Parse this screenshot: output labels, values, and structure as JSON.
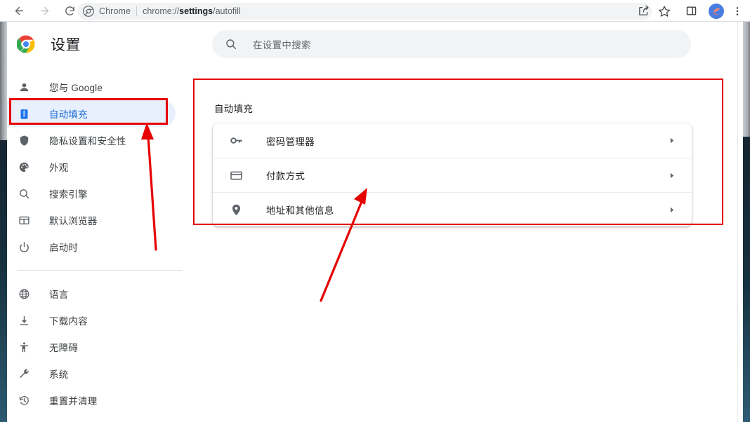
{
  "browser": {
    "back_icon": "back-arrow-icon",
    "forward_icon": "forward-arrow-icon",
    "reload_icon": "reload-icon",
    "omnibox": {
      "chrome_icon": "chrome-logo-icon",
      "scheme_label": "Chrome",
      "url_prefix": "chrome://",
      "url_bold": "settings",
      "url_suffix": "/autofill",
      "full_url": "chrome://settings/autofill"
    },
    "actions": [
      {
        "name": "share-icon",
        "label": "Share"
      },
      {
        "name": "bookmark-star-icon",
        "label": "Bookmark this tab"
      },
      {
        "name": "side-panel-icon",
        "label": "Side panel"
      },
      {
        "name": "avatar",
        "label": "Profile"
      },
      {
        "name": "three-dot-menu-icon",
        "label": "Customize and control Google Chrome"
      }
    ],
    "avatar_bg": "#4a7de0",
    "avatar_fg": "#f08a7a"
  },
  "settings": {
    "brand": {
      "logo_icon": "chrome-logo-icon",
      "title": "设置"
    },
    "search": {
      "icon": "search-icon",
      "placeholder": "在设置中搜索",
      "value": ""
    },
    "sidebar": {
      "group_1": [
        {
          "icon": "person-icon",
          "label": "您与 Google",
          "active": false
        },
        {
          "icon": "clipboard-icon",
          "label": "自动填充",
          "active": true
        },
        {
          "icon": "shield-icon",
          "label": "隐私设置和安全性",
          "active": false
        },
        {
          "icon": "palette-icon",
          "label": "外观",
          "active": false
        },
        {
          "icon": "search-icon",
          "label": "搜索引擎",
          "active": false
        },
        {
          "icon": "browser-icon",
          "label": "默认浏览器",
          "active": false
        },
        {
          "icon": "power-icon",
          "label": "启动时",
          "active": false
        }
      ],
      "group_2": [
        {
          "icon": "globe-icon",
          "label": "语言",
          "active": false
        },
        {
          "icon": "download-icon",
          "label": "下载内容",
          "active": false
        },
        {
          "icon": "accessibility-icon",
          "label": "无障碍",
          "active": false
        },
        {
          "icon": "wrench-icon",
          "label": "系统",
          "active": false
        },
        {
          "icon": "restore-icon",
          "label": "重置并清理",
          "active": false
        }
      ],
      "active_bg": "#e8f0fe",
      "active_fg": "#1967d2"
    },
    "main": {
      "section_title": "自动填充",
      "rows": [
        {
          "icon": "key-icon",
          "label": "密码管理器",
          "arrow": "chevron-right-icon"
        },
        {
          "icon": "credit-card-icon",
          "label": "付款方式",
          "arrow": "chevron-right-icon"
        },
        {
          "icon": "location-pin-icon",
          "label": "地址和其他信息",
          "arrow": "chevron-right-icon"
        }
      ]
    }
  },
  "annotations": {
    "color": "#e60000",
    "highlight_rect_nav": {
      "label": "自动填充 sidebar highlight"
    },
    "highlight_rect_main": {
      "label": "自动填充 section highlight"
    },
    "arrow_1": {
      "label": "points to 自动填充 sidebar item"
    },
    "arrow_2": {
      "label": "points to 自动填充 card rows"
    }
  }
}
